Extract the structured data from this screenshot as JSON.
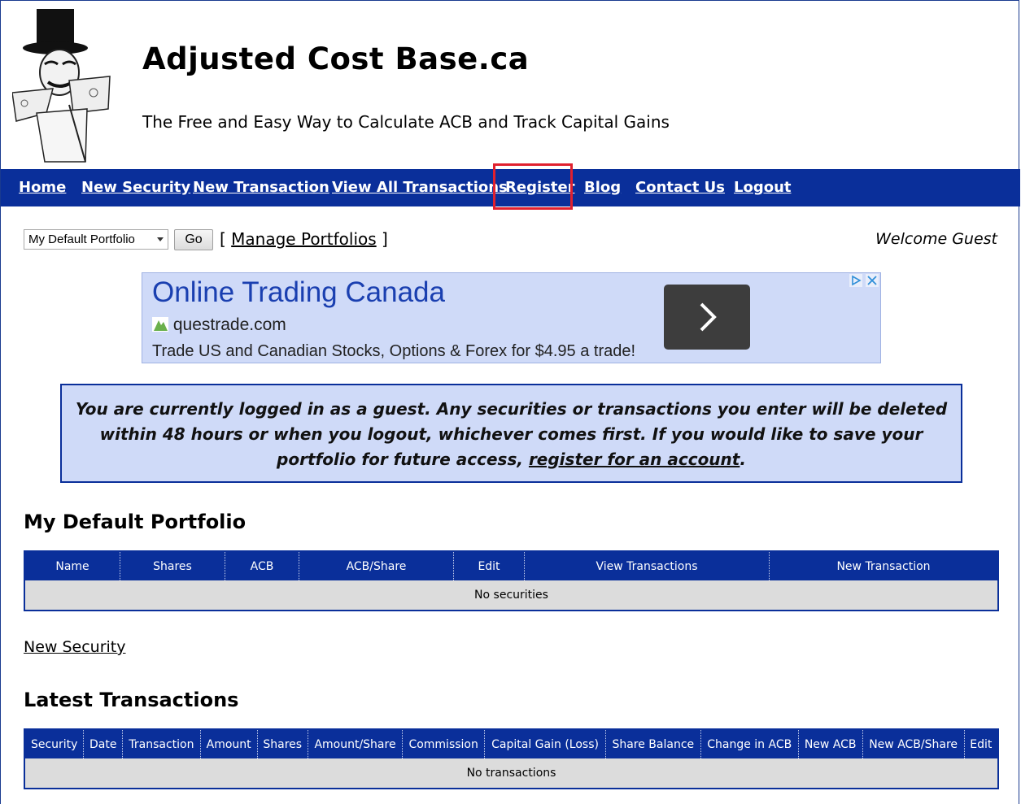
{
  "header": {
    "title": "Adjusted Cost Base.ca",
    "tagline": "The Free and Easy Way to Calculate ACB and Track Capital Gains"
  },
  "nav": {
    "items": [
      "Home",
      "New Security",
      "New Transaction",
      "View All Transactions",
      "Register",
      "Blog",
      "Contact Us",
      "Logout"
    ],
    "highlighted": "Register",
    "highlight_color": "#e0202e",
    "background": "#0a2f9a"
  },
  "toolbar": {
    "portfolio_selected": "My Default Portfolio",
    "go_label": "Go",
    "manage_open": "[",
    "manage_label": "Manage Portfolios",
    "manage_close": "]",
    "welcome": "Welcome Guest"
  },
  "ad": {
    "title": "Online Trading Canada",
    "domain": "questrade.com",
    "description": "Trade US and Canadian Stocks, Options & Forex for $4.95 a trade!",
    "icons": [
      "adchoices-icon",
      "close-icon",
      "chevron-right-icon"
    ]
  },
  "notice": {
    "text": "You are currently logged in as a guest. Any securities or transactions you enter will be deleted within 48 hours or when you logout, whichever comes first. If you would like to save your portfolio for future access,",
    "link": "register for an account",
    "end": "."
  },
  "portfolio": {
    "title": "My Default Portfolio",
    "columns": [
      "Name",
      "Shares",
      "ACB",
      "ACB/Share",
      "Edit",
      "View Transactions",
      "New Transaction"
    ],
    "empty": "No securities"
  },
  "new_security_link": "New Security",
  "transactions": {
    "title": "Latest Transactions",
    "columns": [
      "Security",
      "Date",
      "Transaction",
      "Amount",
      "Shares",
      "Amount/Share",
      "Commission",
      "Capital Gain (Loss)",
      "Share Balance",
      "Change in ACB",
      "New ACB",
      "New ACB/Share",
      "Edit"
    ],
    "empty": "No transactions"
  }
}
